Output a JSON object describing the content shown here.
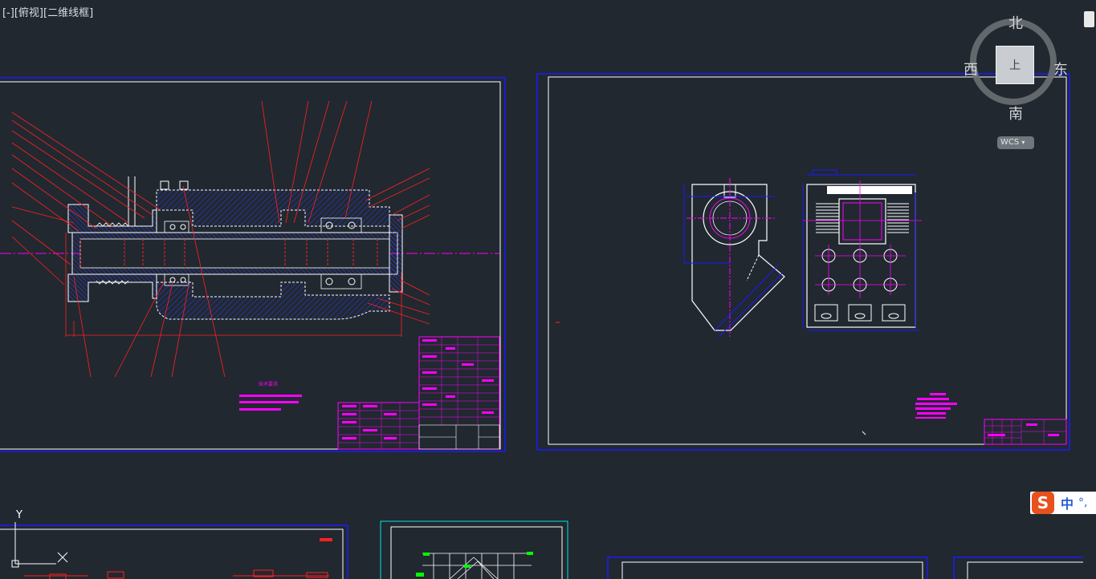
{
  "viewport": {
    "label_parts": [
      "[-]",
      "[俯视]",
      "[二维线框]"
    ]
  },
  "viewcube": {
    "north": "北",
    "south": "南",
    "west": "西",
    "east": "东",
    "face_label": "上",
    "wcs_label": "WCS"
  },
  "drawing1": {
    "tech_note": "技术要求"
  },
  "ime": {
    "logo": "S",
    "mode": "中",
    "punct": "°,"
  },
  "ucs": {
    "y_label": "Y"
  },
  "colors": {
    "background": "#212830",
    "frame_blue": "#1a1aff",
    "frame_white": "#ffffff",
    "red": "#ff2020",
    "magenta": "#ff00ff",
    "hatch_blue": "#2b3bd6",
    "cyan": "#00e5e5",
    "green": "#00ff00"
  }
}
